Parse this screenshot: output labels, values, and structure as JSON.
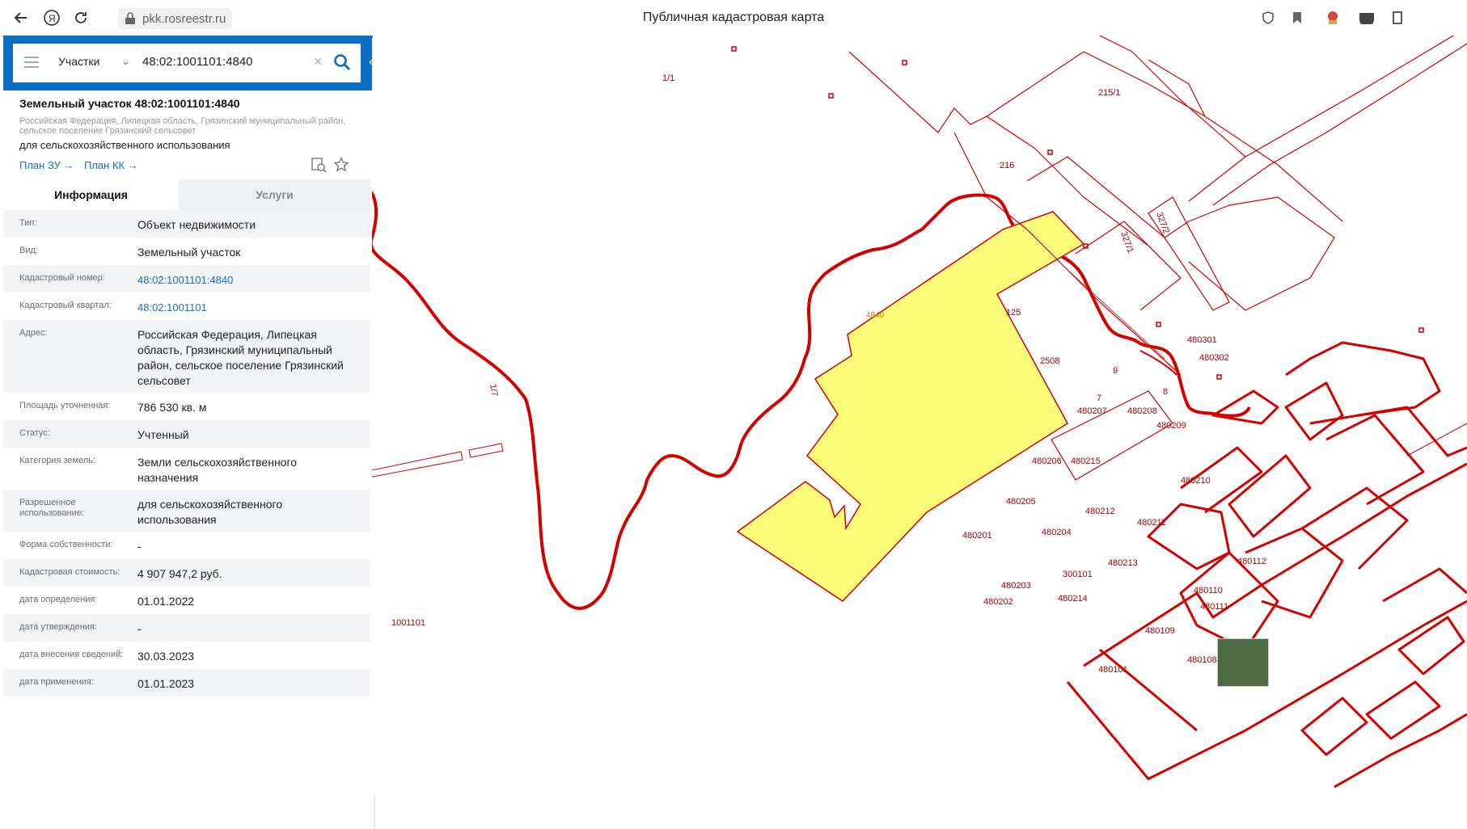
{
  "browser": {
    "url": "pkk.rosreestr.ru",
    "page_title": "Публичная кадастровая карта"
  },
  "search": {
    "layer": "Участки",
    "query": "48:02:1001101:4840"
  },
  "object": {
    "title": "Земельный участок 48:02:1001101:4840",
    "address_short": "Российская Федерация, Липецкая область, Грязинский муниципальный район, сельское поселение Грязинский сельсовет",
    "use": "для сельскохозяйственного использования",
    "links": {
      "plan_zu": "План ЗУ →",
      "plan_kk": "План КК →"
    }
  },
  "tabs": {
    "info": "Информация",
    "services": "Услуги"
  },
  "info_rows": [
    {
      "label": "Тип:",
      "value": "Объект недвижимости"
    },
    {
      "label": "Вид:",
      "value": "Земельный участок"
    },
    {
      "label": "Кадастровый номер:",
      "value": "48:02:1001101:4840"
    },
    {
      "label": "Кадастровый квартал:",
      "value": "48:02:1001101"
    },
    {
      "label": "Адрес:",
      "value": "Российская Федерация, Липецкая область, Грязинский муниципальный район, сельское поселение Грязинский сельсовет"
    },
    {
      "label": "Площадь уточненная:",
      "value": "786 530 кв. м"
    },
    {
      "label": "Статус:",
      "value": "Учтенный"
    },
    {
      "label": "Категория земель:",
      "value": "Земли сельскохозяйственного назначения"
    },
    {
      "label": "Разрешенное использование:",
      "value": "для сельскохозяйственного использования"
    },
    {
      "label": "Форма собственности:",
      "value": "-"
    },
    {
      "label": "Кадастровая стоимость:",
      "value": "4 907 947,2 руб."
    },
    {
      "label": "дата определения:",
      "value": "01.01.2022"
    },
    {
      "label": "дата утверждения:",
      "value": "-"
    },
    {
      "label": "дата внесения сведений:",
      "value": "30.03.2023"
    },
    {
      "label": "дата применения:",
      "value": "01.01.2023"
    }
  ],
  "map": {
    "colors": {
      "boundary": "#d40000",
      "selected_fill": "#fdfd7a",
      "selected_label": "#c08400"
    },
    "selected_label": "4840",
    "labels": [
      "1/1",
      "215/1",
      "216",
      "327/2",
      "327/1",
      "125",
      "2508",
      "1/7",
      "1001101",
      "7",
      "480301",
      "480302",
      "9",
      "8",
      "7",
      "480207",
      "480208",
      "480209",
      "480206",
      "480215",
      "480210",
      "480205",
      "480212",
      "480211",
      "480201",
      "480204",
      "480213",
      "480112",
      "480203",
      "300101",
      "480110",
      "480202",
      "480214",
      "480111",
      "480109",
      "480108",
      "480101"
    ]
  }
}
